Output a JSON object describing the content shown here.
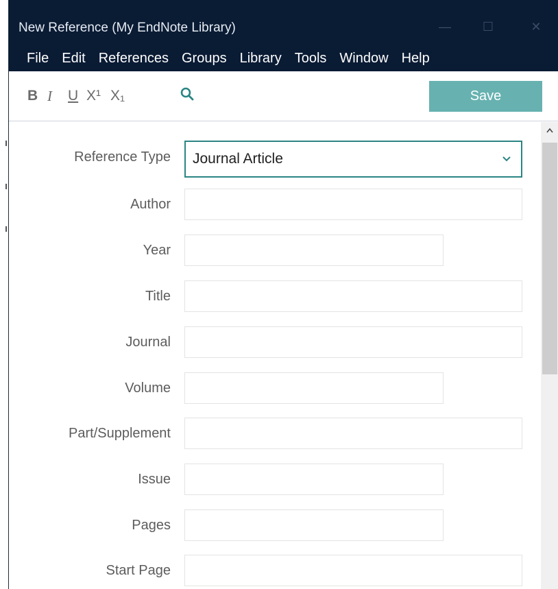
{
  "window": {
    "title": "New Reference (My EndNote Library)",
    "controls": {
      "minimize": "—",
      "maximize": "☐",
      "close": "✕"
    }
  },
  "menu": [
    "File",
    "Edit",
    "References",
    "Groups",
    "Library",
    "Tools",
    "Window",
    "Help"
  ],
  "toolbar": {
    "bold": "B",
    "italic": "I",
    "underline": "U",
    "superscript": "X¹",
    "subscript": "X₁",
    "search_icon": "search-icon",
    "save_label": "Save"
  },
  "form": {
    "reference_type": {
      "label": "Reference Type",
      "value": "Journal Article"
    },
    "fields": [
      {
        "label": "Author",
        "value": ""
      },
      {
        "label": "Year",
        "value": ""
      },
      {
        "label": "Title",
        "value": ""
      },
      {
        "label": "Journal",
        "value": ""
      },
      {
        "label": "Volume",
        "value": ""
      },
      {
        "label": "Part/Supplement",
        "value": ""
      },
      {
        "label": "Issue",
        "value": ""
      },
      {
        "label": "Pages",
        "value": ""
      },
      {
        "label": "Start Page",
        "value": ""
      }
    ]
  },
  "colors": {
    "titlebar": "#0a1b34",
    "accent": "#2a8583",
    "save_button": "#67b2b1"
  }
}
